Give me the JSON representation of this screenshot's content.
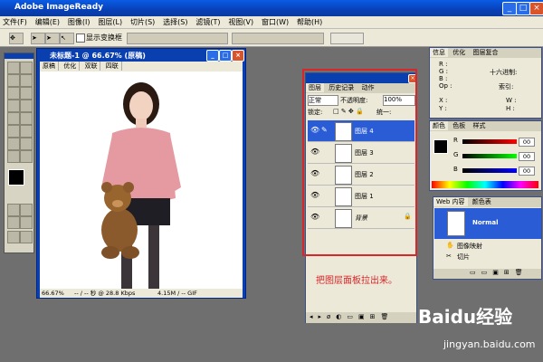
{
  "app": {
    "title": "Adobe ImageReady"
  },
  "menu": [
    "文件(F)",
    "编辑(E)",
    "图像(I)",
    "图层(L)",
    "切片(S)",
    "选择(S)",
    "滤镜(T)",
    "视图(V)",
    "窗口(W)",
    "帮助(H)"
  ],
  "options_bar": {
    "show_transform_label": "显示变换框"
  },
  "document": {
    "title": "未标题-1 @ 66.67% (原稿)",
    "tabs": [
      "原稿",
      "优化",
      "双联",
      "四联"
    ],
    "status": {
      "zoom": "66.67%",
      "speed": "-- / -- 秒 @ 28.8 Kbps",
      "size": "4.15M / -- GIF"
    }
  },
  "layers_panel": {
    "tabs": [
      "图层",
      "历史记录",
      "动作"
    ],
    "blend_mode": "正常",
    "opacity_label": "不透明度:",
    "opacity": "100%",
    "lock_label": "锁定:",
    "unify_label": "统一:",
    "layers": [
      {
        "name": "图层 4",
        "selected": true
      },
      {
        "name": "图层 3",
        "selected": false
      },
      {
        "name": "图层 2",
        "selected": false
      },
      {
        "name": "图层 1",
        "selected": false
      },
      {
        "name": "背景",
        "selected": false
      }
    ]
  },
  "annotation": {
    "text": "把图层面板拉出来。",
    "color": "#d8262a"
  },
  "info_panel": {
    "tabs": [
      "信息",
      "优化",
      "图层复合"
    ],
    "labels": [
      "R :",
      "G :",
      "B :",
      "Op :",
      "X :",
      "Y :"
    ],
    "hex_label": "十六进制:",
    "index_label": "索引:",
    "w_label": "W :",
    "h_label": "H :"
  },
  "color_panel": {
    "tabs": [
      "颜色",
      "色板",
      "样式"
    ],
    "channels": [
      {
        "label": "R",
        "value": "00"
      },
      {
        "label": "G",
        "value": "00"
      },
      {
        "label": "B",
        "value": "00"
      }
    ]
  },
  "web_panel": {
    "tabs": [
      "Web 内容",
      "颜色表"
    ],
    "selected_item": "Normal",
    "items": [
      "图像映射",
      "切片"
    ]
  },
  "watermark": {
    "brand": "Baidu经验",
    "url": "jingyan.baidu.com"
  }
}
